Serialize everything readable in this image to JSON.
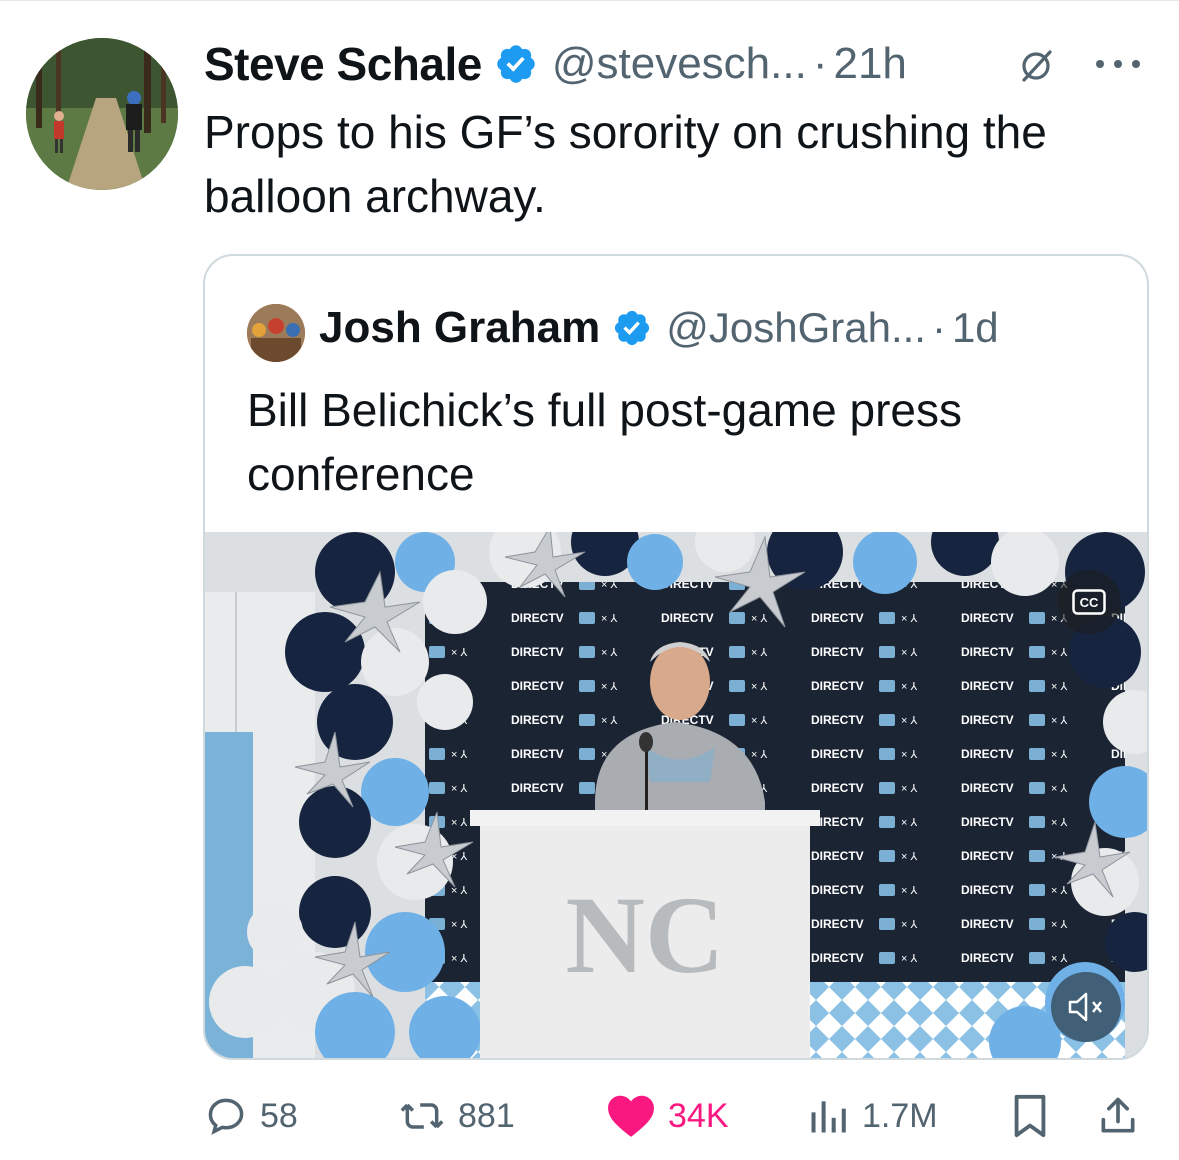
{
  "tweet": {
    "author_name": "Steve Schale",
    "handle": "@stevesch...",
    "separator": "·",
    "time": "21h",
    "text": "Props to his GF’s sorority on crushing the balloon archway.",
    "verified_color": "#1d9bf0"
  },
  "quoted": {
    "author_name": "Josh Graham",
    "handle": "@JoshGrah...",
    "separator": "·",
    "time": "1d",
    "text": "Bill Belichick’s full post-game press conference",
    "video": {
      "backdrop_brand": "DIRECTV",
      "cc_label": "CC",
      "muted": true
    }
  },
  "actions": {
    "replies": "58",
    "reposts": "881",
    "likes": "34K",
    "views": "1.7M",
    "liked": true,
    "like_color": "#f91880"
  },
  "icons": [
    "verified-badge-icon",
    "grok-icon",
    "more-icon",
    "cc-icon",
    "mute-icon",
    "reply-icon",
    "repost-icon",
    "heart-icon",
    "views-icon",
    "bookmark-icon",
    "share-icon"
  ]
}
